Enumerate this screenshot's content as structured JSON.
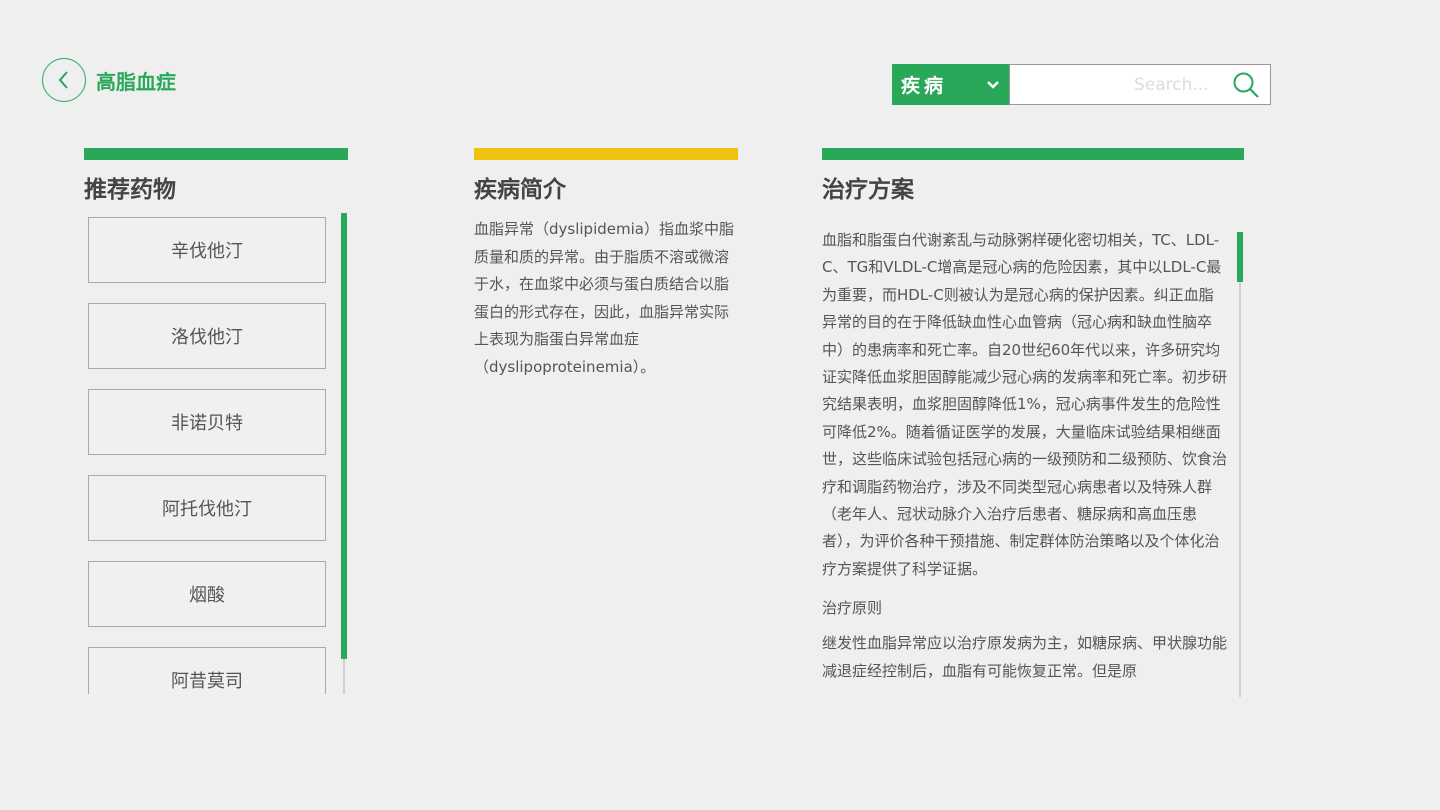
{
  "header": {
    "title": "高脂血症"
  },
  "search": {
    "category": "疾病",
    "placeholder": "Search..."
  },
  "columns": {
    "drugs": {
      "title": "推荐药物",
      "items": [
        "辛伐他汀",
        "洛伐他汀",
        "非诺贝特",
        "阿托伐他汀",
        "烟酸",
        "阿昔莫司"
      ]
    },
    "intro": {
      "title": "疾病简介",
      "text": "血脂异常（dyslipidemia）指血浆中脂质量和质的异常。由于脂质不溶或微溶于水，在血浆中必须与蛋白质结合以脂蛋白的形式存在，因此，血脂异常实际上表现为脂蛋白异常血症（dyslipoproteinemia）。"
    },
    "treatment": {
      "title": "治疗方案",
      "text": "血脂和脂蛋白代谢紊乱与动脉粥样硬化密切相关，TC、LDL-C、TG和VLDL-C增高是冠心病的危险因素，其中以LDL-C最为重要，而HDL-C则被认为是冠心病的保护因素。纠正血脂异常的目的在于降低缺血性心血管病（冠心病和缺血性脑卒中）的患病率和死亡率。自20世纪60年代以来，许多研究均证实降低血浆胆固醇能减少冠心病的发病率和死亡率。初步研究结果表明，血浆胆固醇降低1%，冠心病事件发生的危险性可降低2%。随着循证医学的发展，大量临床试验结果相继面世，这些临床试验包括冠心病的一级预防和二级预防、饮食治疗和调脂药物治疗，涉及不同类型冠心病患者以及特殊人群（老年人、冠状动脉介入治疗后患者、糖尿病和高血压患者），为评价各种干预措施、制定群体防治策略以及个体化治疗方案提供了科学证据。",
      "subheading": "治疗原则",
      "text2": "继发性血脂异常应以治疗原发病为主，如糖尿病、甲状腺功能减退症经控制后，血脂有可能恢复正常。但是原"
    }
  },
  "colors": {
    "accent": "#2aa85a",
    "intro_accent": "#f0c10f",
    "background": "#efefef"
  }
}
